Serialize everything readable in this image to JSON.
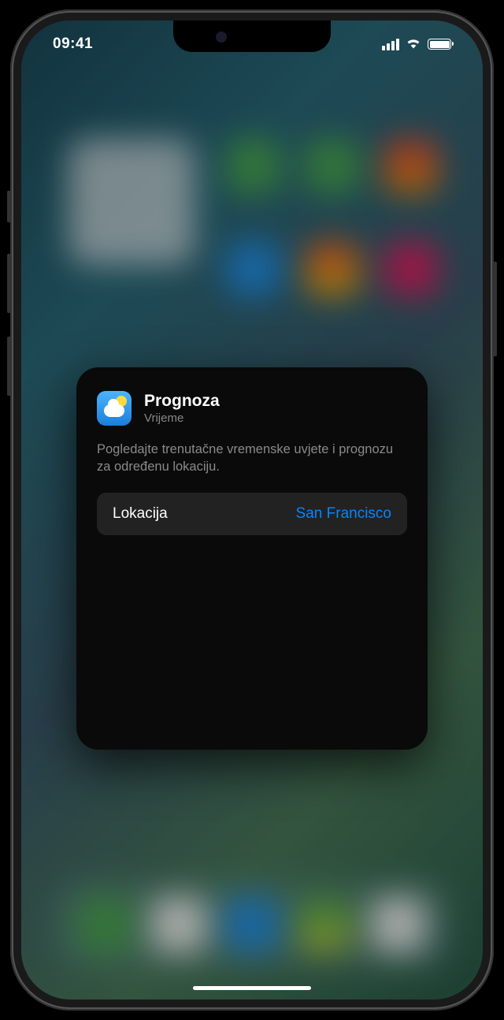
{
  "status": {
    "time": "09:41"
  },
  "widget": {
    "title": "Prognoza",
    "app_name": "Vrijeme",
    "description": "Pogledajte trenutačne vremenske uvjete i prognozu za određenu lokaciju.",
    "setting": {
      "label": "Lokacija",
      "value": "San Francisco"
    }
  }
}
